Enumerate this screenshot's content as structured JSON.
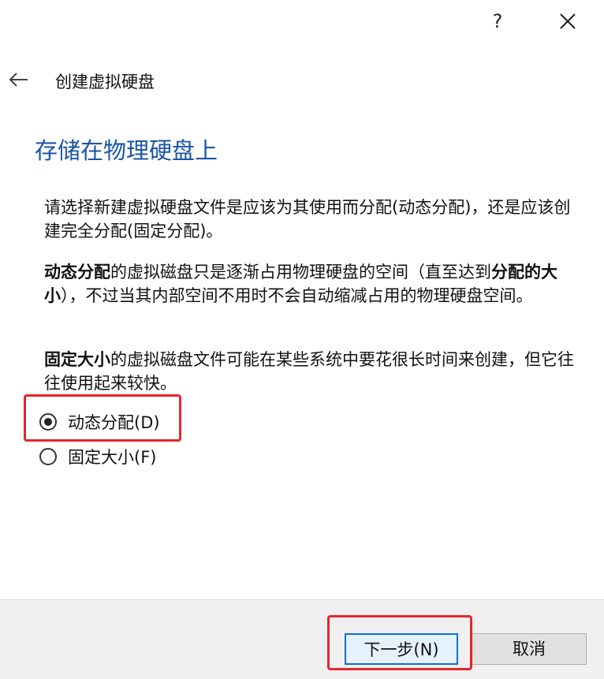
{
  "titlebar": {
    "help_label": "?",
    "close_icon": "close-icon"
  },
  "header": {
    "back_icon": "arrow-left-icon",
    "title": "创建虚拟硬盘"
  },
  "main": {
    "section_title": "存储在物理硬盘上",
    "paragraph1": "请选择新建虚拟硬盘文件是应该为其使用而分配(动态分配)，还是应该创建完全分配(固定分配)。",
    "paragraph2_bold1": "动态分配",
    "paragraph2_text1": "的虚拟磁盘只是逐渐占用物理硬盘的空间（直至达到",
    "paragraph2_bold2": "分配的大小",
    "paragraph2_text2": "），不过当其内部空间不用时不会自动缩减占用的物理硬盘空间。",
    "paragraph3_bold": "固定大小",
    "paragraph3_text": "的虚拟磁盘文件可能在某些系统中要花很长时间来创建，但它往往使用起来较快。",
    "options": [
      {
        "label": "动态分配(D)",
        "selected": true
      },
      {
        "label": "固定大小(F)",
        "selected": false
      }
    ]
  },
  "footer": {
    "next_label": "下一步(N)",
    "cancel_label": "取消"
  },
  "colors": {
    "section_title": "#1a55a6",
    "highlight": "#e8262a",
    "default_button_border": "#0f6fd1"
  }
}
